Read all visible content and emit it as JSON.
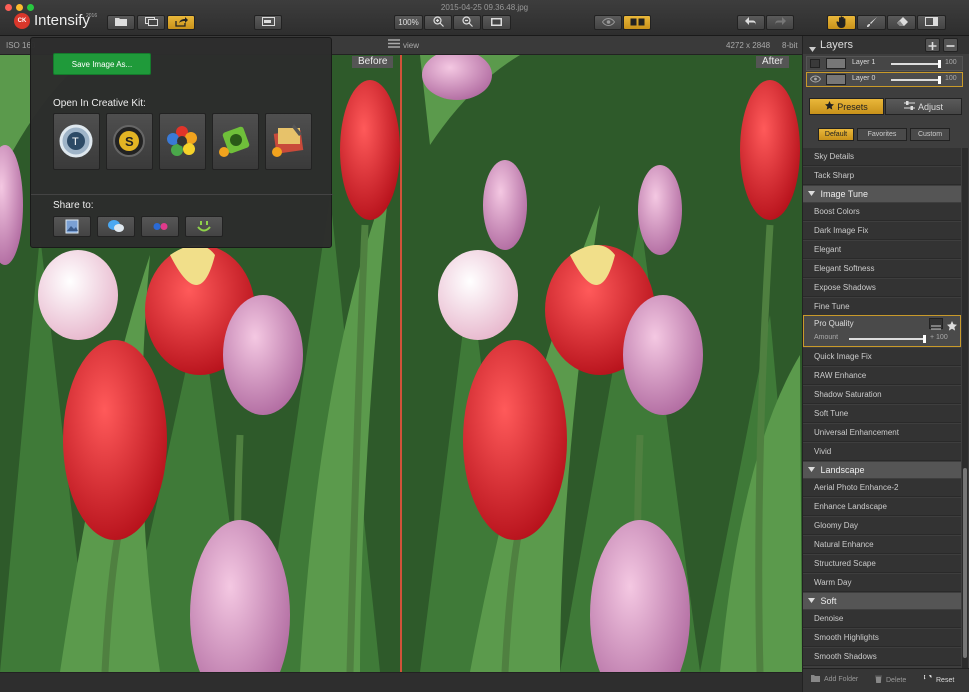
{
  "window": {
    "title": "2015-04-25 09.36.48.jpg"
  },
  "app": {
    "logo": "CK",
    "name": "Intensify",
    "year": "2016"
  },
  "toolbar": {
    "zoom": "100%",
    "zoom_in_icon": "zoom-in-icon",
    "zoom_out_icon": "zoom-out-icon",
    "tools": [
      "open-icon",
      "browse-icon",
      "share-icon",
      "sidebar-icon",
      "eye-icon",
      "compare-icon",
      "undo-icon",
      "redo-icon",
      "hand-icon",
      "brush-icon",
      "eraser-icon",
      "panel-icon"
    ]
  },
  "infobar": {
    "iso": "ISO 160",
    "view_label": "view",
    "dimensions": "4272 x 2848",
    "bitdepth": "8-bit"
  },
  "photo": {
    "before_label": "Before",
    "after_label": "After"
  },
  "popup": {
    "save_button": "Save Image As...",
    "open_heading": "Open In Creative Kit:",
    "creative_kit_apps": [
      "tonality-icon",
      "snapheal-icon",
      "focus-icon",
      "intensify-icon",
      "noiseless-icon"
    ],
    "share_heading": "Share to:",
    "share_targets": [
      "photos-icon",
      "messages-icon",
      "flickr-icon",
      "smugmug-icon"
    ]
  },
  "layers": {
    "title": "Layers",
    "items": [
      {
        "name": "Layer 1",
        "value": "100",
        "level": 1.0
      },
      {
        "name": "Layer 0",
        "value": "100",
        "level": 1.0
      }
    ]
  },
  "panel_tabs": {
    "presets": "Presets",
    "adjust": "Adjust"
  },
  "preset_subtabs": [
    "Default",
    "Favorites",
    "Custom"
  ],
  "presets_top": [
    "Sky Details",
    "Tack Sharp"
  ],
  "categories": {
    "image_tune": {
      "label": "Image Tune",
      "items": [
        "Boost Colors",
        "Dark Image Fix",
        "Elegant",
        "Elegant Softness",
        "Expose Shadows",
        "Fine Tune"
      ]
    },
    "selected": {
      "label": "Pro Quality",
      "amount_label": "Amount",
      "amount_value": "+ 100",
      "amount_level": 1.0
    },
    "image_tune_after": [
      "Quick Image Fix",
      "RAW Enhance",
      "Shadow Saturation",
      "Soft Tune",
      "Universal Enhancement",
      "Vivid"
    ],
    "landscape": {
      "label": "Landscape",
      "items": [
        "Aerial Photo Enhance-2",
        "Enhance Landscape",
        "Gloomy Day",
        "Natural Enhance",
        "Structured Scape",
        "Warm Day"
      ]
    },
    "soft": {
      "label": "Soft",
      "items": [
        "Denoise",
        "Smooth Highlights",
        "Smooth Shadows"
      ]
    }
  },
  "panel_footer": {
    "add_folder": "Add Folder",
    "delete": "Delete",
    "reset": "Reset"
  },
  "colors": {
    "accent": "#e9b73a",
    "save_green": "#1f9a3a",
    "divider": "#d2523a"
  }
}
